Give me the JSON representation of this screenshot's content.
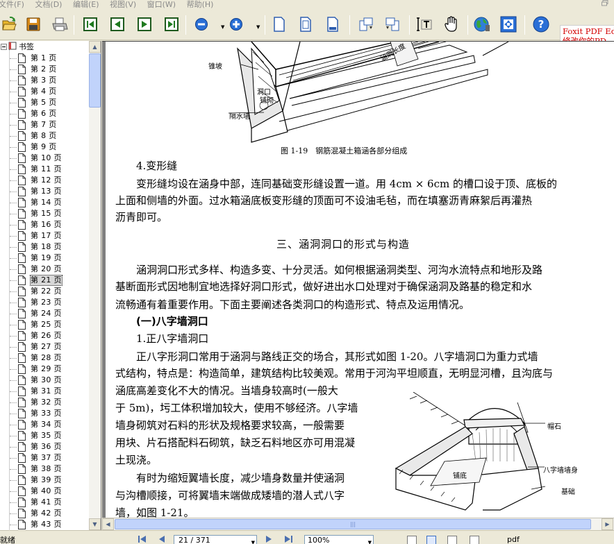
{
  "menu": {
    "items": [
      "文件(F)",
      "文档(D)",
      "编辑(E)",
      "视图(V)",
      "窗口(W)",
      "帮助(H)"
    ]
  },
  "toolbar": {
    "icons": [
      "open-icon",
      "save-icon",
      "print-icon",
      "first-page-icon",
      "previous-page-icon",
      "next-page-icon",
      "last-page-icon",
      "zoom-out-icon",
      "zoom-in-icon",
      "single-page-icon",
      "continuous-page-icon",
      "facing-page-icon",
      "rotate-left-icon",
      "rotate-right-icon",
      "text-select-icon",
      "hand-tool-icon",
      "globe-icon",
      "fit-page-icon",
      "help-icon"
    ],
    "ad_line1": "Foxit PDF Edito",
    "ad_line2": "修改你的PD"
  },
  "bookmarks": {
    "root_label": "书签",
    "selected_index": 20,
    "items": [
      "第 1 页",
      "第 2 页",
      "第 3 页",
      "第 4 页",
      "第 5 页",
      "第 6 页",
      "第 7 页",
      "第 8 页",
      "第 9 页",
      "第 10 页",
      "第 11 页",
      "第 12 页",
      "第 13 页",
      "第 14 页",
      "第 15 页",
      "第 16 页",
      "第 17 页",
      "第 18 页",
      "第 19 页",
      "第 20 页",
      "第 21 页",
      "第 22 页",
      "第 23 页",
      "第 24 页",
      "第 25 页",
      "第 26 页",
      "第 27 页",
      "第 28 页",
      "第 29 页",
      "第 30 页",
      "第 31 页",
      "第 32 页",
      "第 33 页",
      "第 34 页",
      "第 35 页",
      "第 36 页",
      "第 37 页",
      "第 38 页",
      "第 39 页",
      "第 40 页",
      "第 41 页",
      "第 42 页",
      "第 43 页"
    ]
  },
  "document": {
    "fig1_labels": {
      "slope": "锥坡",
      "mouth": "洞口",
      "paving": "铺砌",
      "wall": "隔水墙",
      "length": "涵洞长度"
    },
    "fig1_caption": "图 1-19　钢筋混凝土箱涵各部分组成",
    "h_deformation": "4.变形缝",
    "p1": [
      "变形缝均设在涵身中部，连同基础变形缝设置一道。用 4cm × 6cm 的槽口设于顶、底板的",
      "上面和侧墙的外面。过水箱涵底板变形缝的顶面可不设油毛毡，而在填塞沥青麻絮后再灌热",
      "沥青即可。"
    ],
    "section_title": "三、涵洞洞口的形式与构造",
    "p2": [
      "涵洞洞口形式多样、构造多变、十分灵活。如何根据涵洞类型、河沟水流特点和地形及路",
      "基断面形式因地制宜地选择好洞口形式，做好进出水口处理对于确保涵洞及路基的稳定和水",
      "流畅通有着重要作用。下面主要阐述各类洞口的构造形式、特点及运用情况。"
    ],
    "h_bazi": "(一)八字墙洞口",
    "h_zheng": "1.正八字墙洞口",
    "p3": [
      "正八字形洞口常用于涵洞与路线正交的场合，其形式如图 1-20。八字墙洞口为重力式墙",
      "式结构，特点是：构造简单，建筑结构比较美观。常用于河沟平坦顺直，无明显河槽，且沟底与",
      "涵底高差变化不大的情况。当墙身较高时(一般大",
      "于 5m)，圬工体积增加较大，使用不够经济。八字墙",
      "墙身砌筑对石料的形状及规格要求较高，一般需要",
      "用块、片石搭配料石砌筑，缺乏石料地区亦可用混凝",
      "土现浇。"
    ],
    "p4": [
      "有时为缩短翼墙长度，减少墙身数量并使涵洞",
      "与沟槽顺接，可将翼墙末端做成矮墙的潜人式八字",
      "墙，如图 1-21。"
    ],
    "fig2_labels": {
      "cap": "帽石",
      "body": "八字墙墙身",
      "base": "基础",
      "floor": "铺底"
    }
  },
  "statusbar": {
    "left_text": "就绪",
    "page_indicator": "21 / 371",
    "zoom": "100%",
    "right_text": "pdf"
  }
}
